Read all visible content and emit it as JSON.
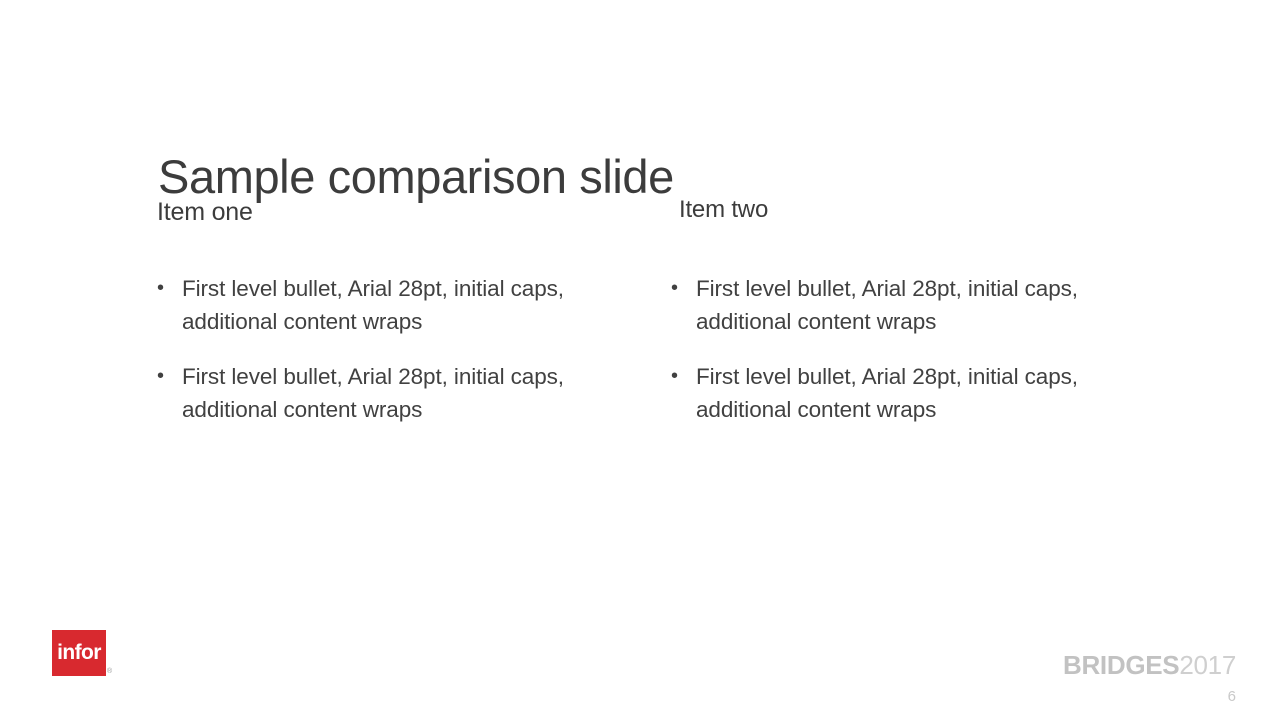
{
  "slide": {
    "title": "Sample comparison slide",
    "page_number": "6",
    "columns": [
      {
        "heading": "Item one",
        "bullets": [
          {
            "marker": "•",
            "text": "First level bullet, Arial 28pt, initial caps, additional content wraps"
          },
          {
            "marker": "•",
            "text": "First level bullet, Arial 28pt, initial caps, additional content wraps"
          }
        ]
      },
      {
        "heading": "Item two",
        "bullets": [
          {
            "marker": "•",
            "text": "First level bullet, Arial 28pt, initial caps, additional content wraps"
          },
          {
            "marker": "•",
            "text": "First level bullet, Arial 28pt, initial caps, additional content wraps"
          }
        ]
      }
    ]
  },
  "branding": {
    "infor": {
      "wordmark": "infor",
      "trademark": "®",
      "color": "#d8292f"
    },
    "bridges": {
      "word": "BRIDGES",
      "year": "2017",
      "word_color": "#c2c2c2",
      "year_color": "#cfcfcf"
    }
  },
  "theme": {
    "background": "#ffffff",
    "title_color": "#3c3c3c",
    "body_color": "#414141",
    "page_number_color": "#c9c9c9"
  }
}
